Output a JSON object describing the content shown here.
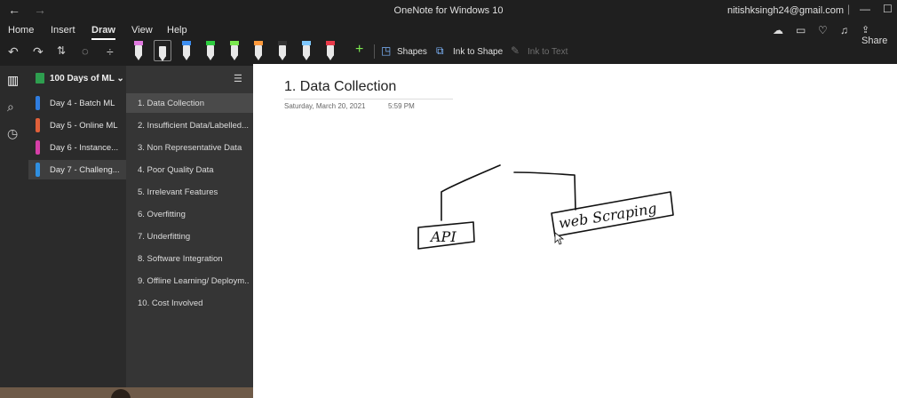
{
  "titlebar": {
    "back": "←",
    "forward": "→",
    "app_title": "OneNote for Windows 10",
    "account": "nitishksingh24@gmail.com",
    "minimize": "—",
    "maximize": "☐"
  },
  "ribbon": {
    "tabs": [
      {
        "label": "Home"
      },
      {
        "label": "Insert"
      },
      {
        "label": "Draw"
      },
      {
        "label": "View"
      },
      {
        "label": "Help"
      }
    ],
    "share_label": "Share"
  },
  "toolbar": {
    "pens": [
      {
        "name": "highlighter-purple",
        "band": "#e07ae0"
      },
      {
        "name": "pen-black",
        "band": "#222222"
      },
      {
        "name": "pen-blue",
        "band": "#3d8ef0"
      },
      {
        "name": "pen-green",
        "band": "#2ecc40"
      },
      {
        "name": "highlighter-green",
        "band": "#7be84f"
      },
      {
        "name": "pen-orange",
        "band": "#ff9a3c"
      },
      {
        "name": "pen-black-2",
        "band": "#333333"
      },
      {
        "name": "pen-light-blue",
        "band": "#7fc8ff"
      },
      {
        "name": "pen-red",
        "band": "#e83a4a"
      }
    ],
    "add_pen": "+",
    "shapes_label": "Shapes",
    "ink_to_shape_label": "Ink to Shape",
    "ink_to_text_label": "Ink to Text"
  },
  "notebook": {
    "name": "100 Days of ML",
    "chevron": "⌄",
    "sections": [
      {
        "label": "Day 4 - Batch ML",
        "color": "#2f7de0"
      },
      {
        "label": "Day 5 - Online ML",
        "color": "#e0603a"
      },
      {
        "label": "Day 6 - Instance...",
        "color": "#d63fa8"
      },
      {
        "label": "Day 7 - Challeng...",
        "color": "#2f8fe0"
      }
    ]
  },
  "pages": [
    {
      "label": "1. Data Collection"
    },
    {
      "label": "2. Insufficient Data/Labelled..."
    },
    {
      "label": "3. Non Representative Data"
    },
    {
      "label": "4. Poor Quality Data"
    },
    {
      "label": "5. Irrelevant Features"
    },
    {
      "label": "6. Overfitting"
    },
    {
      "label": "7. Underfitting"
    },
    {
      "label": "8. Software Integration"
    },
    {
      "label": "9. Offline Learning/ Deploym..."
    },
    {
      "label": "10. Cost Involved"
    }
  ],
  "page": {
    "title": "1. Data Collection",
    "date": "Saturday, March 20, 2021",
    "time": "5:59 PM",
    "ink_text": {
      "left_box": "API",
      "right_box": "web Scraping"
    }
  }
}
